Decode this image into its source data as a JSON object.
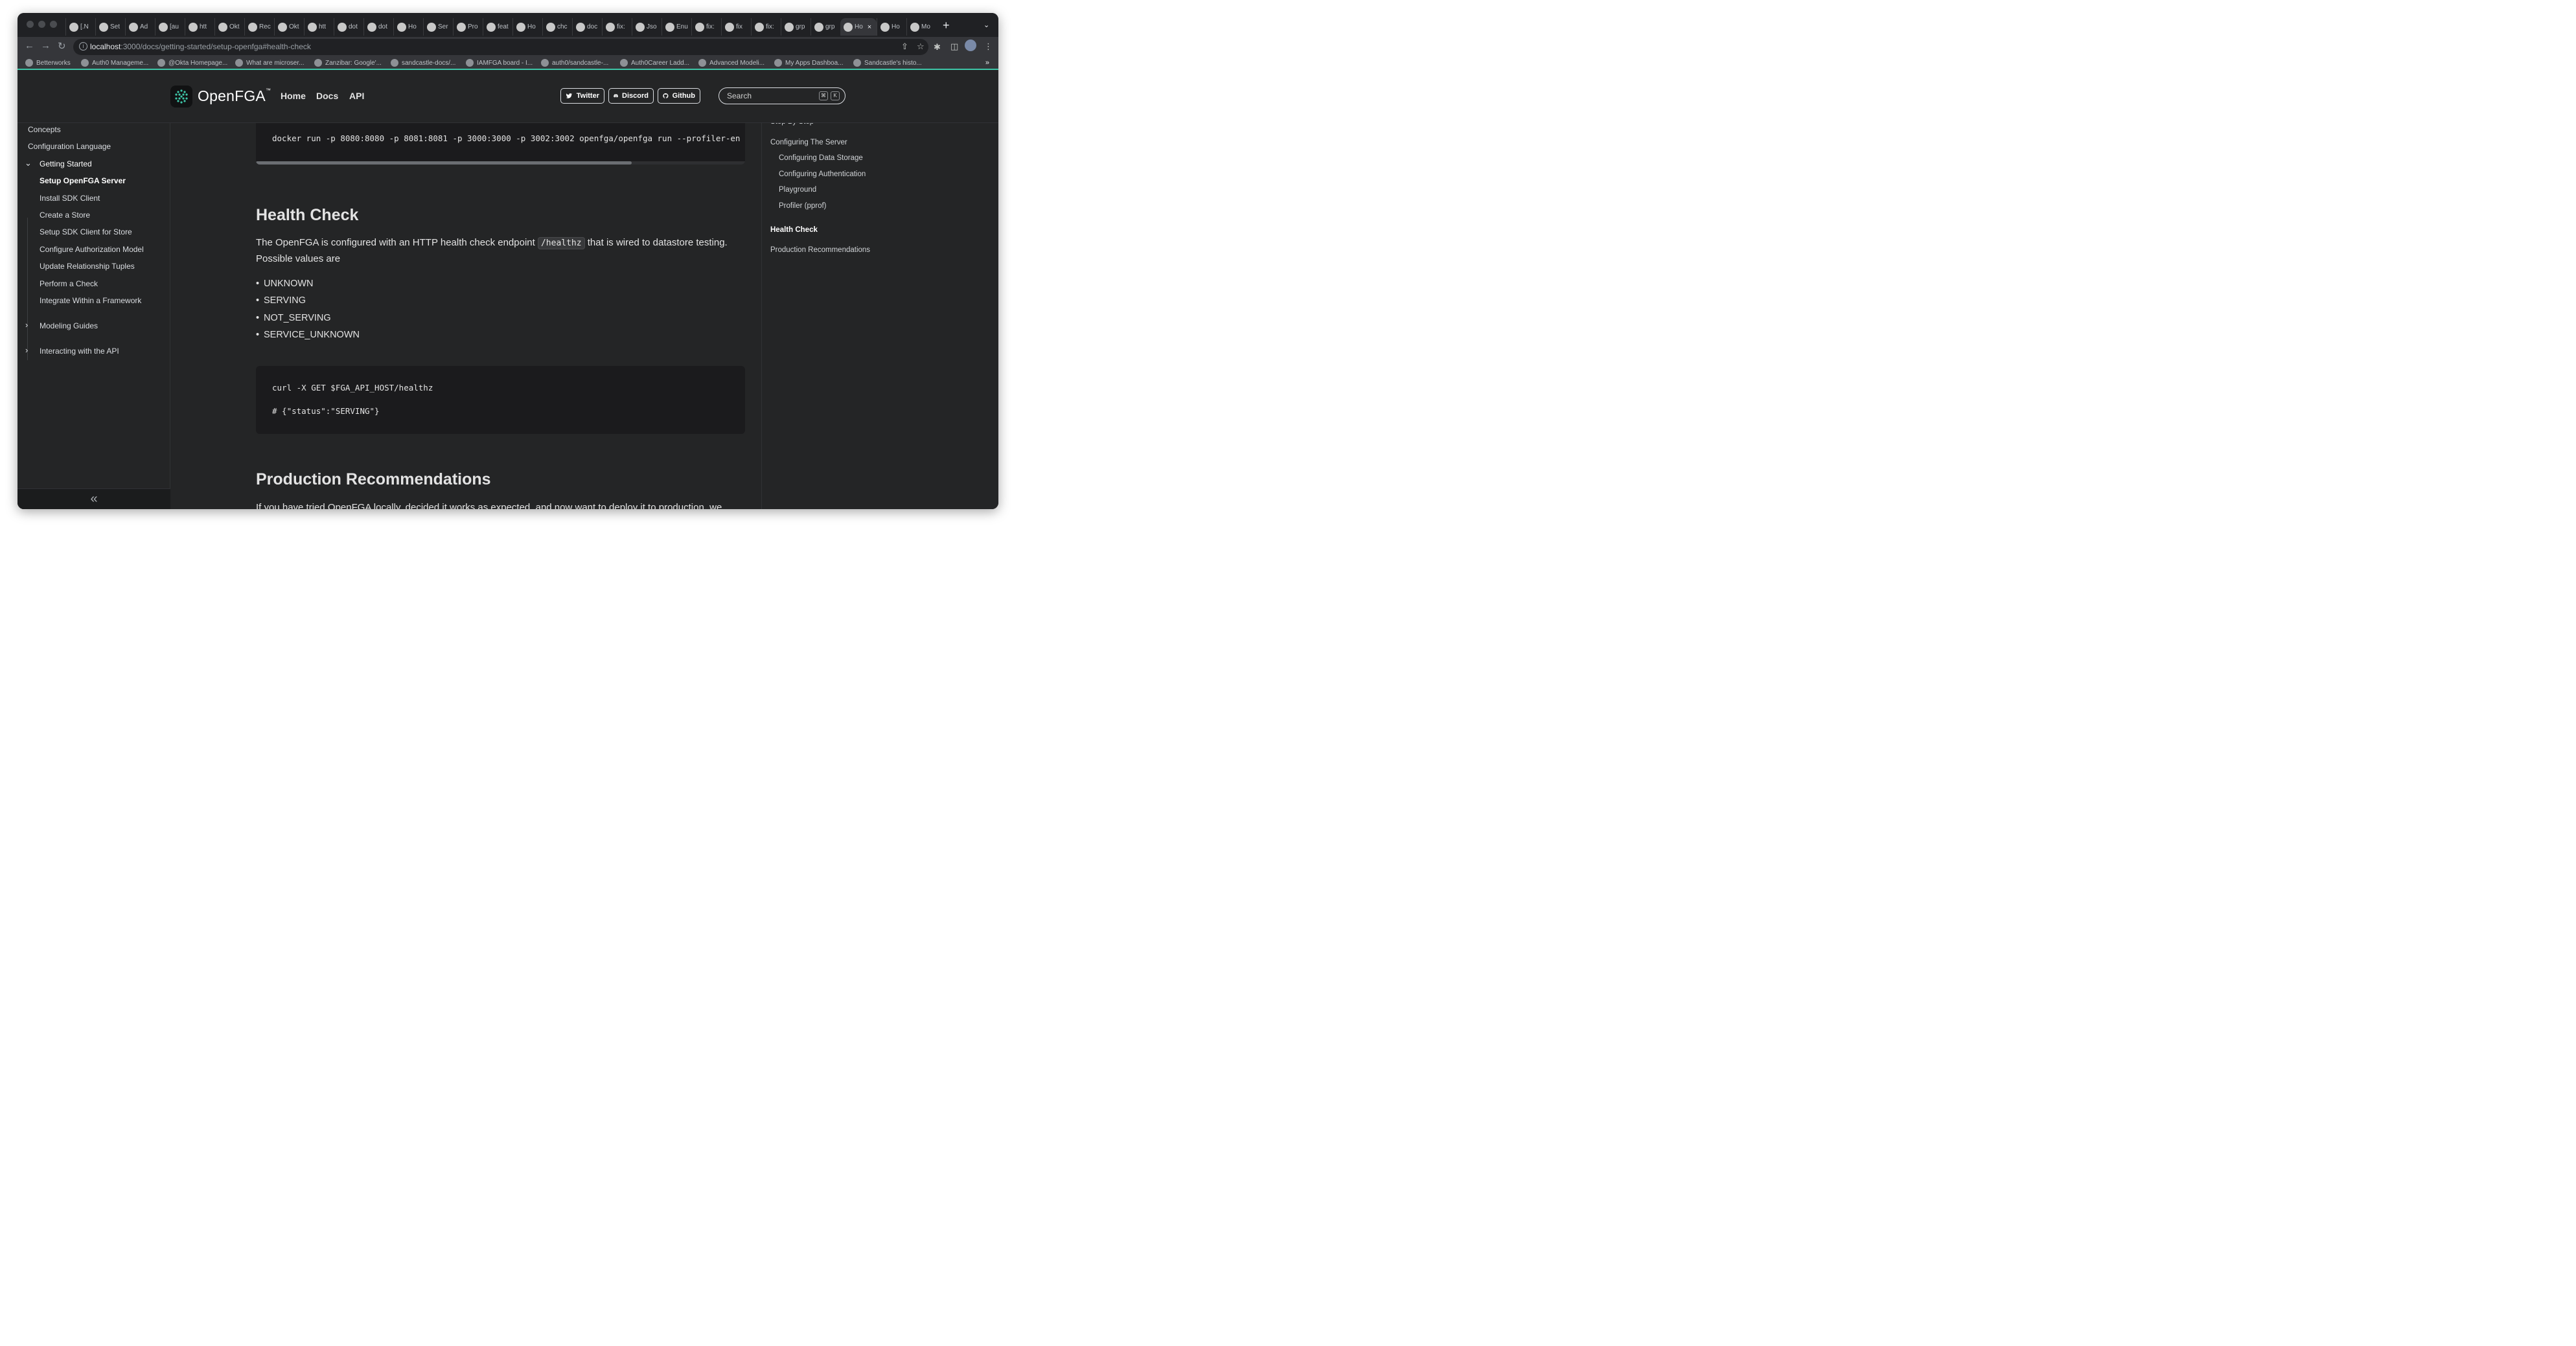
{
  "browser": {
    "tabs": [
      {
        "label": "[.N",
        "icon": "github-icon"
      },
      {
        "label": "Set",
        "icon": "openfga-icon"
      },
      {
        "label": "Ad",
        "icon": "github-icon"
      },
      {
        "label": "[au",
        "icon": "gmail-icon"
      },
      {
        "label": "htt",
        "icon": "globe-icon"
      },
      {
        "label": "Okt",
        "icon": "jira-icon"
      },
      {
        "label": "Rec",
        "icon": "confluence-icon"
      },
      {
        "label": "Okt",
        "icon": "jira-icon"
      },
      {
        "label": "htt",
        "icon": "confluence-icon"
      },
      {
        "label": "dot",
        "icon": "github-icon"
      },
      {
        "label": "dot",
        "icon": "github-icon"
      },
      {
        "label": "Ho",
        "icon": "microsoft-icon"
      },
      {
        "label": "Ser",
        "icon": "b-icon"
      },
      {
        "label": "Pro",
        "icon": "github-icon"
      },
      {
        "label": "feat",
        "icon": "circleci-icon"
      },
      {
        "label": "Ho",
        "icon": "openfga-icon"
      },
      {
        "label": "chc",
        "icon": "github-icon"
      },
      {
        "label": "doc",
        "icon": "github-icon"
      },
      {
        "label": "fix:",
        "icon": "github-icon"
      },
      {
        "label": "Jso",
        "icon": "github-icon"
      },
      {
        "label": "Enu",
        "icon": "microsoft-icon"
      },
      {
        "label": "fix:",
        "icon": "github-icon"
      },
      {
        "label": "fix",
        "icon": "globe-icon"
      },
      {
        "label": "fix:",
        "icon": "circleci-icon"
      },
      {
        "label": "grp",
        "icon": "doc-icon"
      },
      {
        "label": "grp",
        "icon": "github-icon"
      }
    ],
    "active_tab": {
      "label": "Ho",
      "icon": "openfga-icon"
    },
    "after_tabs": [
      {
        "label": "Ho",
        "icon": "stack-icon"
      },
      {
        "label": "Mo",
        "icon": "auth0-icon"
      }
    ],
    "url_host": "localhost",
    "url_path": ":3000/docs/getting-started/setup-openfga#health-check",
    "bookmarks": [
      "Betterworks",
      "Auth0 Manageme...",
      "@Okta Homepage...",
      "What are microser...",
      "Zanzibar: Google'...",
      "sandcastle-docs/...",
      "IAMFGA board - I...",
      "auth0/sandcastle-...",
      "Auth0Career Ladd...",
      "Advanced Modeli...",
      "My Apps Dashboa...",
      "Sandcastle's histo..."
    ]
  },
  "site": {
    "logo_text": "OpenFGA",
    "logo_tm": "™",
    "nav": [
      "Home",
      "Docs",
      "API"
    ],
    "social": [
      "Twitter",
      "Discord",
      "Github"
    ],
    "search_placeholder": "Search",
    "search_keys": [
      "⌘",
      "K"
    ]
  },
  "sidebar": {
    "items": [
      {
        "label": "Concepts",
        "level": 0
      },
      {
        "label": "Configuration Language",
        "level": 0
      },
      {
        "label": "Getting Started",
        "level": 0,
        "expanded": true
      },
      {
        "label": "Setup OpenFGA Server",
        "level": 1,
        "active": true
      },
      {
        "label": "Install SDK Client",
        "level": 1
      },
      {
        "label": "Create a Store",
        "level": 1
      },
      {
        "label": "Setup SDK Client for Store",
        "level": 1
      },
      {
        "label": "Configure Authorization Model",
        "level": 1
      },
      {
        "label": "Update Relationship Tuples",
        "level": 1
      },
      {
        "label": "Perform a Check",
        "level": 1
      },
      {
        "label": "Integrate Within a Framework",
        "level": 1
      },
      {
        "label": "Modeling Guides",
        "level": 0,
        "collapsed": true
      },
      {
        "label": "Interacting with the API",
        "level": 0,
        "collapsed": true
      }
    ],
    "collapse_label": "«"
  },
  "content": {
    "docker_command": "docker run -p 8080:8080 -p 8081:8081 -p 3000:3000 -p 3002:3002 openfga/openfga run --profiler-en",
    "health_heading": "Health Check",
    "health_text_1": "The OpenFGA is configured with an HTTP health check endpoint",
    "health_code": "/healthz",
    "health_text_2": "that is wired to datastore testing.",
    "health_text_3": "Possible values are",
    "values": [
      "UNKNOWN",
      "SERVING",
      "NOT_SERVING",
      "SERVICE_UNKNOWN"
    ],
    "curl_line": "curl -X GET $FGA_API_HOST/healthz",
    "curl_comment": "# {\"status\":\"SERVING\"}",
    "prod_heading": "Production Recommendations",
    "prod_text": "If you have tried OpenFGA locally, decided it works as expected, and now want to deploy it to production, we"
  },
  "toc": {
    "items": [
      {
        "label": "Step By Step",
        "level": 0
      },
      {
        "label": "Configuring The Server",
        "level": 0
      },
      {
        "label": "Configuring Data Storage",
        "level": 1
      },
      {
        "label": "Configuring Authentication",
        "level": 1
      },
      {
        "label": "Playground",
        "level": 1
      },
      {
        "label": "Profiler (pprof)",
        "level": 1
      },
      {
        "label": "Health Check",
        "level": 0,
        "active": true
      },
      {
        "label": "Production Recommendations",
        "level": 0
      }
    ]
  },
  "colors": {
    "accent_line": "#3ec6a8",
    "page_bg": "#242526",
    "code_bg": "#1b1b1d"
  }
}
